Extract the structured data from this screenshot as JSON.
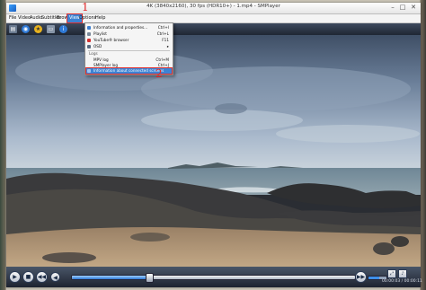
{
  "window": {
    "title": "4K (3840x2160), 30 fps (HDR10+) - 1.mp4 - SMPlayer"
  },
  "menubar": {
    "items": [
      "File",
      "Video",
      "Audio",
      "Subtitles",
      "Browse",
      "View",
      "Options",
      "Help"
    ],
    "active": "View"
  },
  "view_menu": {
    "items": [
      {
        "label": "Information and properties...",
        "shortcut": "Ctrl+I"
      },
      {
        "label": "Playlist",
        "shortcut": "Ctrl+L"
      },
      {
        "label": "YouTube® browser",
        "shortcut": "F11"
      },
      {
        "label": "OSD",
        "shortcut": ""
      },
      {
        "section": "Logs"
      },
      {
        "label": "MPV log",
        "shortcut": "Ctrl+M"
      },
      {
        "label": "SMPlayer log",
        "shortcut": "Ctrl+J"
      },
      {
        "label": "Information about connected screens",
        "shortcut": ""
      }
    ]
  },
  "annotations": {
    "first": "1",
    "second": "2"
  },
  "controls": {
    "time": "00:00:03 / 00:00:11",
    "progress": 0.27,
    "volume": 0.6
  }
}
